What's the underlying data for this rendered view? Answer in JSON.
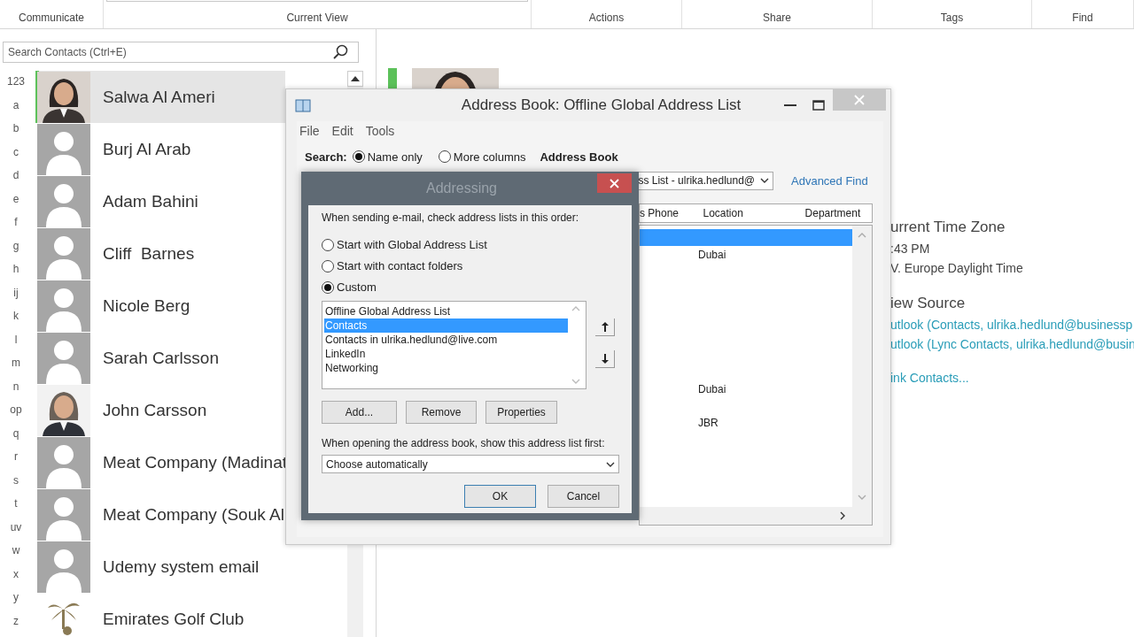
{
  "ribbon": {
    "groups": [
      {
        "label": "Communicate"
      },
      {
        "label": "Current View"
      },
      {
        "label": "Actions"
      },
      {
        "label": "Share"
      },
      {
        "label": "Tags"
      },
      {
        "label": "Find"
      }
    ]
  },
  "contacts_pane": {
    "search": {
      "placeholder": "Search Contacts (Ctrl+E)"
    },
    "index": [
      "123",
      "a",
      "b",
      "c",
      "d",
      "e",
      "f",
      "g",
      "h",
      "ij",
      "k",
      "l",
      "m",
      "n",
      "op",
      "q",
      "r",
      "s",
      "t",
      "uv",
      "w",
      "x",
      "y",
      "z"
    ],
    "contacts": [
      {
        "name": "Salwa Al Ameri",
        "selected": true
      },
      {
        "name": "Burj Al Arab",
        "selected": false,
        "kind": "placeholder"
      },
      {
        "name": "Adam Bahini",
        "selected": false,
        "kind": "placeholder"
      },
      {
        "name": "Cliff  Barnes",
        "selected": false,
        "kind": "placeholder"
      },
      {
        "name": "Nicole Berg",
        "selected": false,
        "kind": "placeholder"
      },
      {
        "name": "Sarah Carlsson",
        "selected": false,
        "kind": "placeholder"
      },
      {
        "name": "John Carsson",
        "selected": false
      },
      {
        "name": "Meat Company (Madinat",
        "selected": false,
        "kind": "placeholder"
      },
      {
        "name": "Meat Company (Souk Al",
        "selected": false,
        "kind": "placeholder"
      },
      {
        "name": "Udemy system email",
        "selected": false,
        "kind": "placeholder"
      },
      {
        "name": "Emirates Golf Club",
        "selected": false,
        "kind": "logo"
      }
    ]
  },
  "contact_card": {
    "time_zone_heading": "urrent Time Zone",
    "time": ":43 PM",
    "time_zone": "V. Europe Daylight Time",
    "view_source_heading": "iew Source",
    "sources": [
      "utlook (Contacts, ulrika.hedlund@businessp",
      "utlook (Lync Contacts, ulrika.hedlund@busin"
    ],
    "link_contacts": "ink Contacts..."
  },
  "address_book": {
    "title": "Address Book: Offline Global Address List",
    "menu": [
      "File",
      "Edit",
      "Tools"
    ],
    "search_label": "Search:",
    "search_modes": [
      {
        "label": "Name only",
        "selected": true
      },
      {
        "label": "More columns",
        "selected": false
      }
    ],
    "address_book_label": "Address Book",
    "address_list": "ss List - ulrika.hedlund@",
    "advanced_find": "Advanced Find",
    "columns": [
      "s Phone",
      "Location",
      "Department"
    ],
    "rows": [
      {
        "selected": true
      },
      {
        "selected": false,
        "location": "Dubai"
      },
      {
        "selected": false
      },
      {
        "selected": false
      },
      {
        "selected": false
      },
      {
        "selected": false
      },
      {
        "selected": false
      },
      {
        "selected": false
      },
      {
        "selected": false
      },
      {
        "selected": false,
        "location": "Dubai"
      },
      {
        "selected": false
      },
      {
        "selected": false,
        "location": "JBR"
      }
    ]
  },
  "addressing_dialog": {
    "title": "Addressing",
    "instruction": "When sending e-mail, check address lists in this order:",
    "options": [
      {
        "label": "Start with Global Address List",
        "selected": false
      },
      {
        "label": "Start with contact folders",
        "selected": false
      },
      {
        "label": "Custom",
        "selected": true
      }
    ],
    "lists": [
      {
        "label": "Offline Global Address List",
        "selected": false
      },
      {
        "label": "Contacts",
        "selected": true
      },
      {
        "label": "Contacts in ulrika.hedlund@live.com",
        "selected": false
      },
      {
        "label": "LinkedIn",
        "selected": false
      },
      {
        "label": "Networking",
        "selected": false
      }
    ],
    "buttons": [
      "Add...",
      "Remove",
      "Properties"
    ],
    "startup_label": "When opening the address book, show this address list first:",
    "startup_list": "Choose automatically",
    "footer_buttons": [
      {
        "label": "OK",
        "default": true
      },
      {
        "label": "Cancel",
        "default": false
      }
    ]
  }
}
